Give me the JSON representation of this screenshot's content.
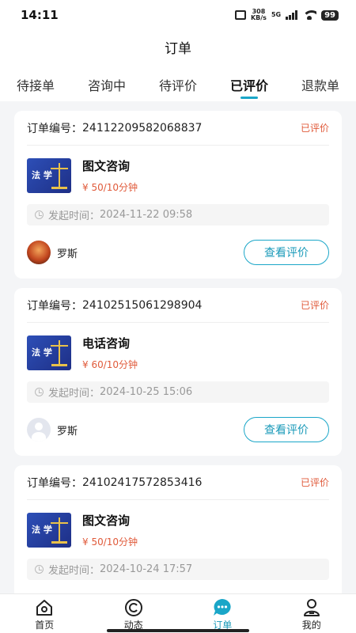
{
  "status_bar": {
    "time": "14:11",
    "net_speed_top": "308",
    "net_speed_bottom": "KB/s",
    "net_type": "5G",
    "battery": "99"
  },
  "header": {
    "title": "订单"
  },
  "tabs": [
    {
      "label": "待接单"
    },
    {
      "label": "咨询中"
    },
    {
      "label": "待评价"
    },
    {
      "label": "已评价"
    },
    {
      "label": "退款单"
    }
  ],
  "active_tab": 3,
  "orders": [
    {
      "order_label": "订单编号：",
      "order_no": "24112209582068837",
      "status": "已评价",
      "thumb_text": "法 学",
      "service_name": "图文咨询",
      "price": "¥ 50/10分钟",
      "time_label": "发起时间：",
      "time_value": "2024-11-22 09:58",
      "user_name": "罗斯",
      "action": "查看评价"
    },
    {
      "order_label": "订单编号：",
      "order_no": "24102515061298904",
      "status": "已评价",
      "thumb_text": "法 学",
      "service_name": "电话咨询",
      "price": "¥ 60/10分钟",
      "time_label": "发起时间：",
      "time_value": "2024-10-25 15:06",
      "user_name": "罗斯",
      "action": "查看评价"
    },
    {
      "order_label": "订单编号：",
      "order_no": "24102417572853416",
      "status": "已评价",
      "thumb_text": "法 学",
      "service_name": "图文咨询",
      "price": "¥ 50/10分钟",
      "time_label": "发起时间：",
      "time_value": "2024-10-24 17:57",
      "user_name": "",
      "action": ""
    }
  ],
  "bottom_nav": [
    {
      "label": "首页",
      "icon": "home-icon"
    },
    {
      "label": "动态",
      "icon": "activity-icon"
    },
    {
      "label": "订单",
      "icon": "order-chat-icon"
    },
    {
      "label": "我的",
      "icon": "profile-icon"
    }
  ],
  "colors": {
    "accent": "#1aa6c8",
    "status_red": "#e05a3a"
  }
}
